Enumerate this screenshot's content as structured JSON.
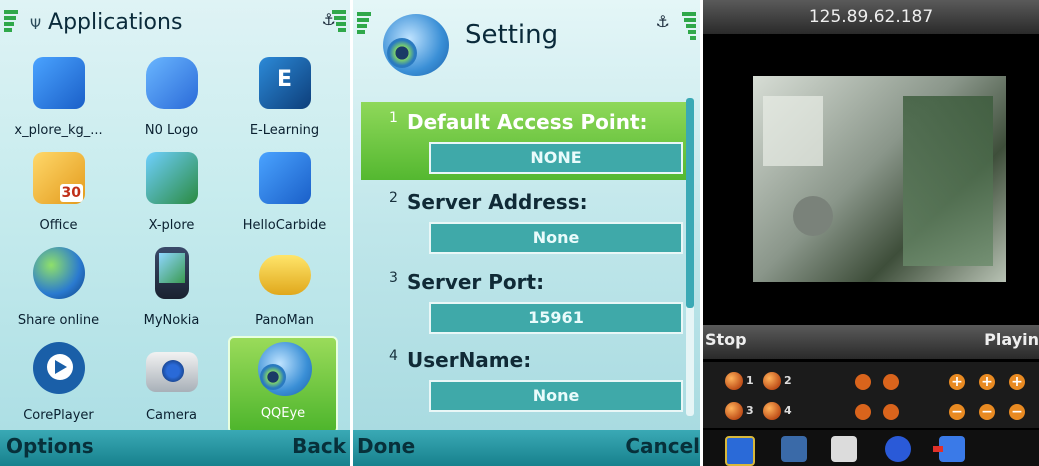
{
  "panel1": {
    "title": "Applications",
    "apps": [
      {
        "label": "x_plore_kg_...",
        "icon": "x-plore-icon"
      },
      {
        "label": "N0 Logo",
        "icon": "puzzle-icon"
      },
      {
        "label": "E-Learning",
        "icon": "e-learning-icon"
      },
      {
        "label": "Office",
        "icon": "office-folder-icon"
      },
      {
        "label": "X-plore",
        "icon": "x-plore-app-icon"
      },
      {
        "label": "HelloCarbide",
        "icon": "hello-carbide-icon"
      },
      {
        "label": "Share online",
        "icon": "globe-icon"
      },
      {
        "label": "MyNokia",
        "icon": "phone-icon"
      },
      {
        "label": "PanoMan",
        "icon": "panoman-icon"
      },
      {
        "label": "CorePlayer",
        "icon": "play-icon"
      },
      {
        "label": "Camera",
        "icon": "camera-icon"
      },
      {
        "label": "QQEye",
        "icon": "qqeye-icon"
      }
    ],
    "soft_left": "Options",
    "soft_right": "Back",
    "calendar_day": "30"
  },
  "panel2": {
    "title": "Setting",
    "fields": [
      {
        "num": "1",
        "name": "Default Access Point:",
        "value": "NONE"
      },
      {
        "num": "2",
        "name": "Server Address:",
        "value": "None"
      },
      {
        "num": "3",
        "name": "Server Port:",
        "value": "15961"
      },
      {
        "num": "4",
        "name": "UserName:",
        "value": "None"
      }
    ],
    "soft_left": "Done",
    "soft_right": "Cancel"
  },
  "panel3": {
    "ip": "125.89.62.187",
    "left_label": "Stop",
    "right_label": "Playin",
    "channels": [
      "1",
      "2",
      "3",
      "4"
    ]
  },
  "colors": {
    "accent_teal": "#3aa9b5",
    "selection_green": "#54b830",
    "signal_green": "#2fa84a",
    "control_orange": "#d9641c"
  }
}
